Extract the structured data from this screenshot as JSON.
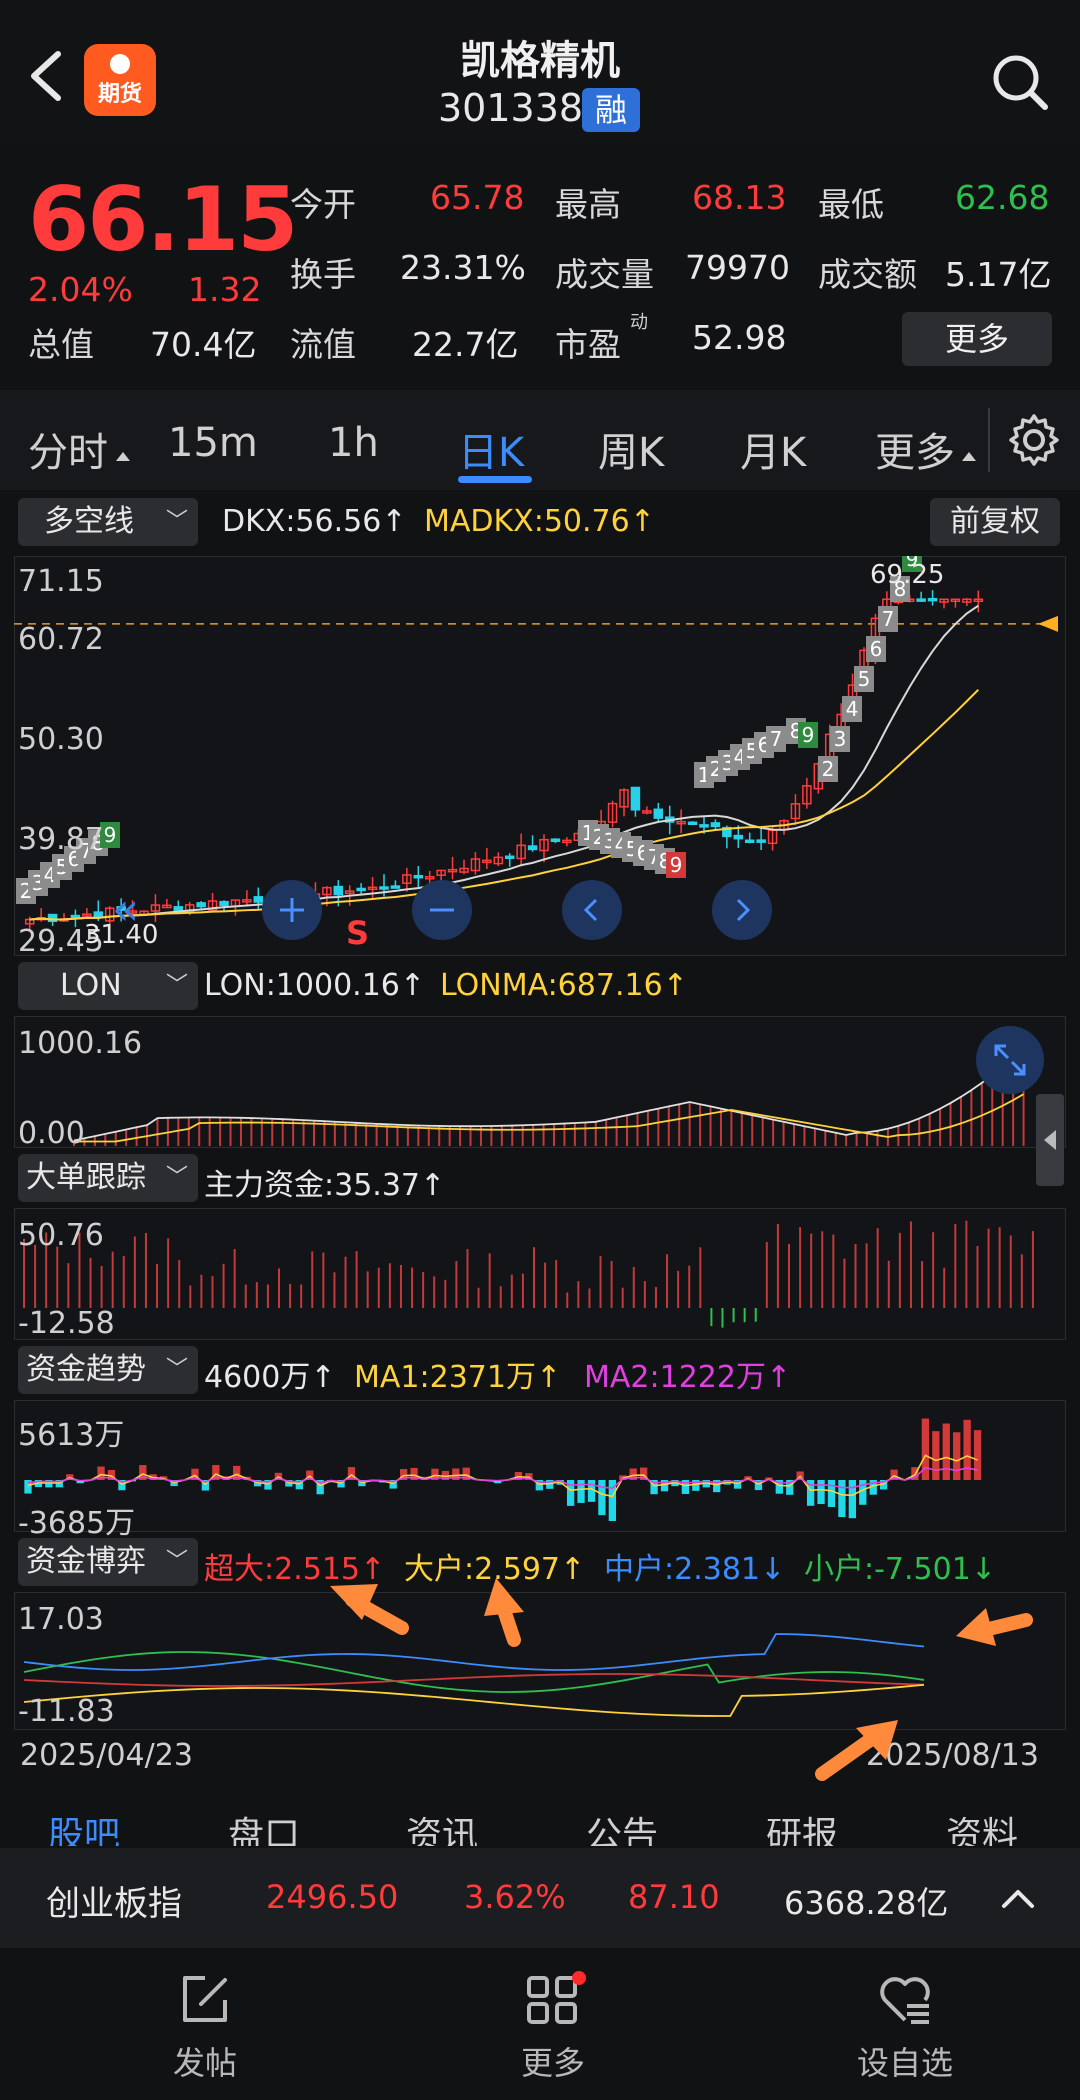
{
  "header": {
    "stock_name": "凯格精机",
    "stock_code": "301338",
    "badge": "融",
    "app_logo_label": "期货"
  },
  "quote": {
    "price": "66.15",
    "change_pct": "2.04%",
    "change_amt": "1.32",
    "open_label": "今开",
    "open": "65.78",
    "high_label": "最高",
    "high": "68.13",
    "low_label": "最低",
    "low": "62.68",
    "turnover_label": "换手",
    "turnover": "23.31%",
    "volume_label": "成交量",
    "volume": "79970",
    "amount_label": "成交额",
    "amount": "5.17亿",
    "total_value_label": "总值",
    "total_value": "70.4亿",
    "float_value_label": "流值",
    "float_value": "22.7亿",
    "pe_label": "市盈",
    "pe_sup": "动",
    "pe": "52.98",
    "more_label": "更多"
  },
  "tabs": [
    "分时",
    "15m",
    "1h",
    "日K",
    "周K",
    "月K",
    "更多"
  ],
  "active_tab": "日K",
  "main_chart": {
    "selector": "多空线",
    "dkx": "DKX:56.56↑",
    "madkx": "MADKX:50.76↑",
    "adjust": "前复权",
    "y_labels": [
      "71.15",
      "60.72",
      "50.30",
      "39.87",
      "29.45"
    ],
    "high_label": "69.25",
    "low_label": "31.40",
    "sell_marker": "S",
    "nine_count_left": [
      "2",
      "3",
      "4",
      "5",
      "6",
      "7",
      "8",
      "9"
    ],
    "nine_count_mid_up": [
      "1",
      "2",
      "3",
      "4",
      "5",
      "6",
      "7"
    ],
    "nine_count_mid_down": [
      "1",
      "2",
      "3",
      "4",
      "5",
      "6",
      "7",
      "8",
      "9"
    ],
    "nine_count_right_a": [
      "8",
      "9"
    ],
    "nine_count_right_b": [
      "2",
      "3",
      "4",
      "5",
      "6",
      "7",
      "8",
      "9"
    ],
    "colors": {
      "up": "#ff3b3b",
      "down": "#2ad0e8",
      "dkx": "#d8d8d8",
      "madkx": "#ffd23c"
    }
  },
  "lon": {
    "selector": "LON",
    "lon": "LON:1000.16↑",
    "lonma": "LONMA:687.16↑",
    "y_labels": [
      "1000.16",
      "0.00"
    ]
  },
  "big_order": {
    "selector": "大单跟踪",
    "value": "主力资金:35.37↑",
    "y_labels": [
      "50.76",
      "-12.58"
    ]
  },
  "fund_trend": {
    "selector": "资金趋势",
    "value": "4600万↑",
    "ma1": "MA1:2371万↑",
    "ma2": "MA2:1222万↑",
    "y_labels": [
      "5613万",
      "-3685万"
    ]
  },
  "fund_game": {
    "selector": "资金博弈",
    "super": "超大:2.515↑",
    "large": "大户:2.597↑",
    "medium": "中户:2.381↓",
    "small": "小户:-7.501↓",
    "y_labels": [
      "17.03",
      "-11.83"
    ],
    "date_start": "2025/04/23",
    "date_end": "2025/08/13"
  },
  "sub_tabs": [
    "股吧",
    "盘口",
    "资讯",
    "公告",
    "研报",
    "资料"
  ],
  "index_bar": {
    "name": "创业板指",
    "value": "2496.50",
    "pct": "3.62%",
    "change": "87.10",
    "amount": "6368.28亿"
  },
  "bottom_nav": {
    "post": "发帖",
    "more": "更多",
    "watchlist": "设自选"
  }
}
